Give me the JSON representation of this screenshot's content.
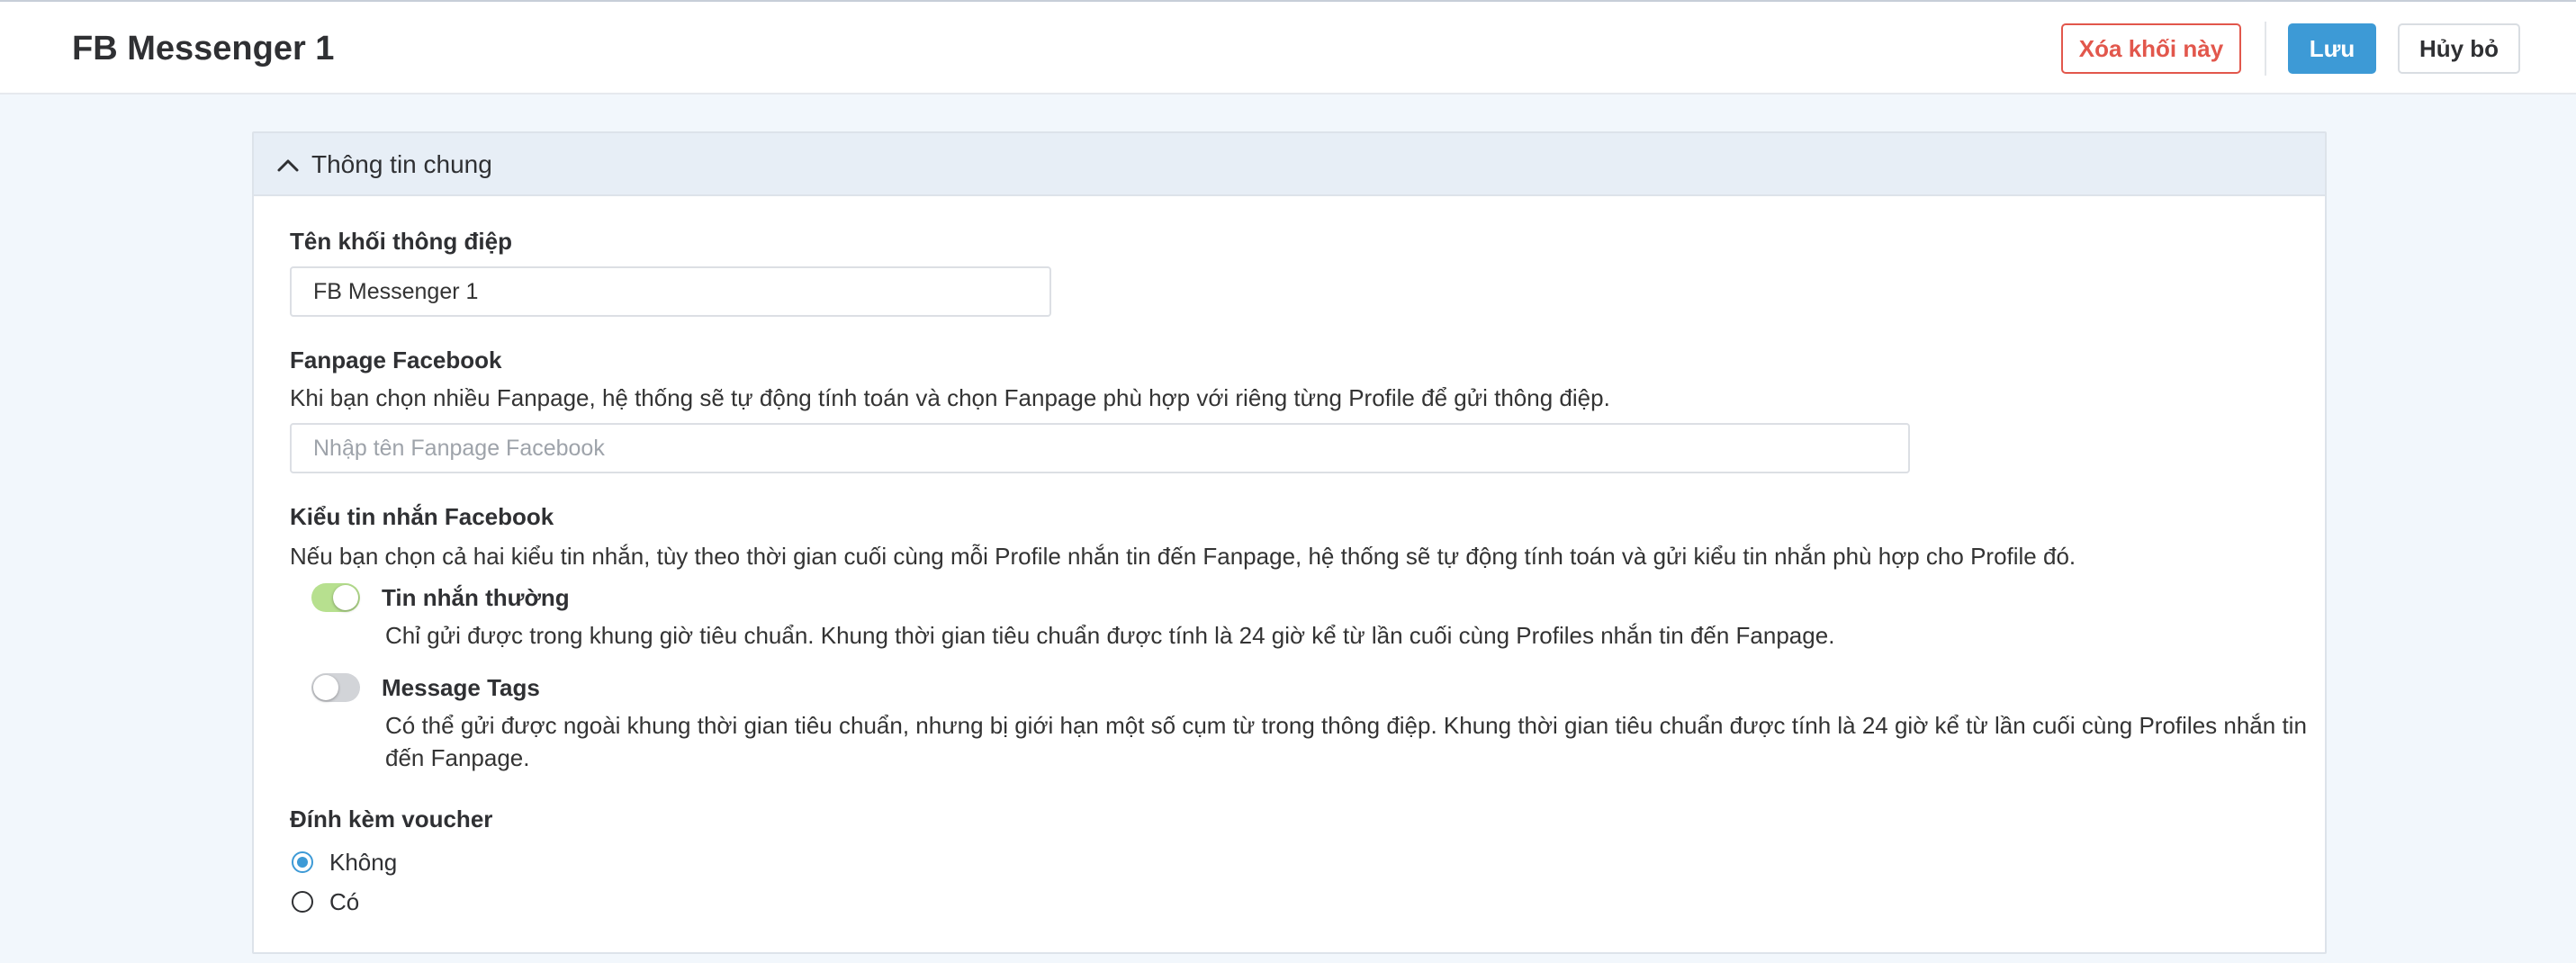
{
  "header": {
    "title": "FB Messenger 1",
    "delete_label": "Xóa khối này",
    "save_label": "Lưu",
    "cancel_label": "Hủy bỏ"
  },
  "section": {
    "title": "Thông tin chung",
    "icon": "chevron-up-icon"
  },
  "message_block_name": {
    "label": "Tên khối thông điệp",
    "value": "FB Messenger 1"
  },
  "fanpage": {
    "label": "Fanpage Facebook",
    "description": "Khi bạn chọn nhiều Fanpage, hệ thống sẽ tự động tính toán và chọn Fanpage phù hợp với riêng từng Profile để gửi thông điệp.",
    "placeholder": "Nhập tên Fanpage Facebook"
  },
  "message_type": {
    "label": "Kiểu tin nhắn Facebook",
    "description": "Nếu bạn chọn cả hai kiểu tin nhắn, tùy theo thời gian cuối cùng mỗi Profile nhắn tin đến Fanpage, hệ thống sẽ tự động tính toán và gửi kiểu tin nhắn phù hợp cho Profile đó.",
    "options": [
      {
        "label": "Tin nhắn thường",
        "enabled": true,
        "description": "Chỉ gửi được trong khung giờ tiêu chuẩn. Khung thời gian tiêu chuẩn được tính là 24 giờ kể từ lần cuối cùng Profiles nhắn tin đến Fanpage."
      },
      {
        "label": "Message Tags",
        "enabled": false,
        "description_line1": "Có thể gửi được ngoài khung thời gian tiêu chuẩn, nhưng bị giới hạn một số cụm từ trong thông điệp. Khung thời gian tiêu chuẩn được tính là 24 giờ kể từ lần cuối cùng Profiles nhắn tin",
        "description_line2": "đến Fanpage."
      }
    ]
  },
  "voucher": {
    "label": "Đính kèm voucher",
    "options": [
      {
        "label": "Không",
        "selected": true
      },
      {
        "label": "Có",
        "selected": false
      }
    ]
  },
  "colors": {
    "primary": "#3d9ad6",
    "danger": "#e2574c",
    "toggle_on": "#b7e08f",
    "toggle_off": "#d2d4d8"
  }
}
